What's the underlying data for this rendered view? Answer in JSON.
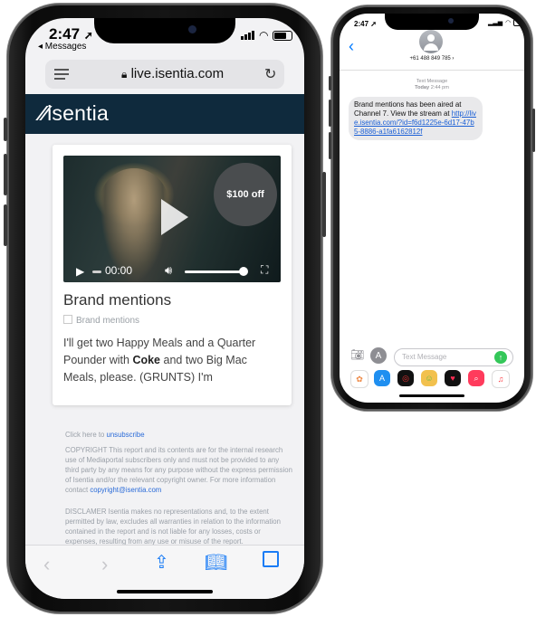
{
  "safari_phone": {
    "status": {
      "time": "2:47",
      "back_app": "◂ Messages"
    },
    "address_bar": {
      "url": "live.isentia.com"
    },
    "site": {
      "logo": "isentia",
      "video": {
        "badge": "$100 off",
        "timecode": "00:00"
      },
      "title": "Brand mentions",
      "category": "Brand mentions",
      "body_pre": "I'll get two Happy Meals and a Quarter Pounder with ",
      "body_bold": "Coke",
      "body_post": " and two Big Mac Meals, please. (GRUNTS) I'm"
    },
    "footer": {
      "unsub_pre": "Click here to ",
      "unsub_link": "unsubscribe",
      "copyright": "COPYRIGHT This report and its contents are for the internal research use of Mediaportal subscribers only and must not be provided to any third party by any means for any purpose without the express permission of Isentia and/or the relevant copyright owner. For more information contact ",
      "copyright_link": "copyright@isentia.com",
      "disclaimer": "DISCLAMER Isentia makes no representations and, to the extent permitted by law, excludes all warranties in relation to the information contained in the report and is not liable for any losses, costs or expenses, resulting from any use or misuse of the report."
    }
  },
  "messages_phone": {
    "status": {
      "time": "2:47"
    },
    "contact": {
      "number": "+61 488 849 785 ›"
    },
    "thread": {
      "type": "Text Message",
      "date": "Today",
      "time": "2:44 pm"
    },
    "message": {
      "text": "Brand mentions has been aired at Channel 7. View the stream at ",
      "link": "http://live.isentia.com/?id=f6d1225e-6d17-47b5-8886-a1fa6162812f"
    },
    "input": {
      "placeholder": "Text Message"
    },
    "colors": {
      "link": "#1a5fd6",
      "send": "#34c759",
      "back": "#007aff"
    }
  }
}
